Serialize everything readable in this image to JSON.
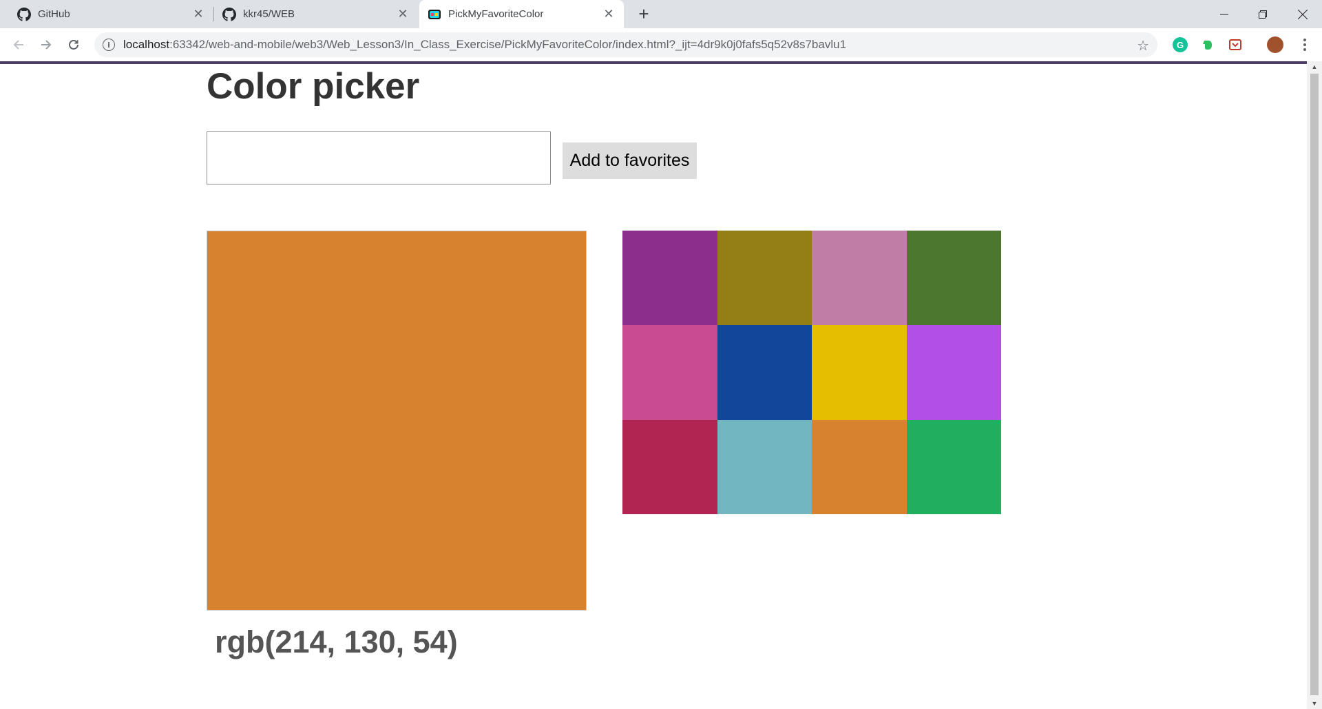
{
  "browser": {
    "tabs": [
      {
        "title": "GitHub",
        "icon": "github-icon"
      },
      {
        "title": "kkr45/WEB",
        "icon": "github-icon"
      },
      {
        "title": "PickMyFavoriteColor",
        "icon": "app-favicon",
        "active": true
      }
    ],
    "url_host": "localhost",
    "url_rest": ":63342/web-and-mobile/web3/Web_Lesson3/In_Class_Exercise/PickMyFavoriteColor/index.html?_ijt=4dr9k0j0fafs5q52v8s7bavlu1",
    "accent_color": "#4b3e64"
  },
  "page": {
    "title": "Color picker",
    "input_value": "",
    "add_button_label": "Add to favorites",
    "selected_color": "#d6822f",
    "selected_label": "rgb(214, 130, 54)",
    "palette": [
      "#8b2e8c",
      "#947e16",
      "#c07ea6",
      "#4b772e",
      "#c94c93",
      "#11469a",
      "#e6be01",
      "#b14fe6",
      "#b02552",
      "#71b6c0",
      "#d6822f",
      "#21ae5e"
    ]
  }
}
